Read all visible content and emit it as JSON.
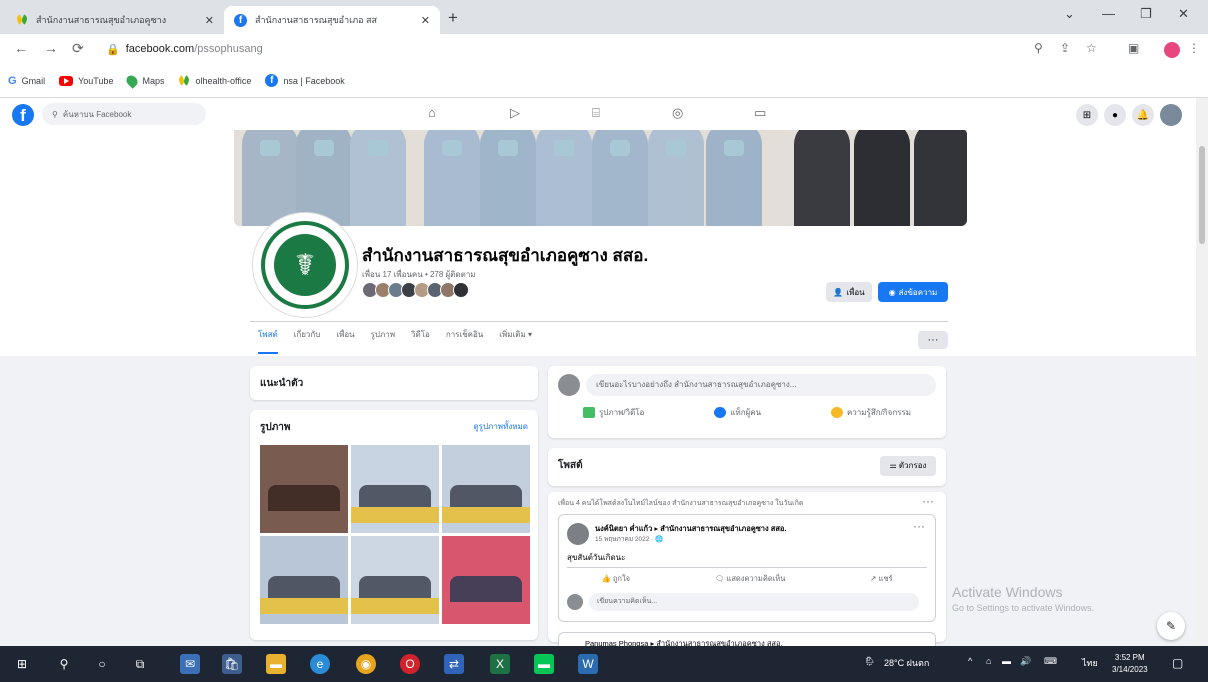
{
  "browser": {
    "tabs": [
      {
        "title": "สำนักงานสาธารณสุขอำเภอคูซาง"
      },
      {
        "title": "สำนักงานสาธารณสุขอำเภอ สส"
      }
    ],
    "url_host": "facebook.com",
    "url_path": "/pssophusang",
    "bookmarks": [
      "Gmail",
      "YouTube",
      "Maps",
      "olhealth-office",
      "nsa | Facebook"
    ]
  },
  "facebook": {
    "search_placeholder": "ค้นหาบน Facebook",
    "page_name": "สำนักงานสาธารณสุขอำเภอคูซาง สสอ.",
    "page_stats": "เพื่อน 17 เพื่อนคน • 278 ผู้ติดตาม",
    "friend_button": "เพื่อน",
    "message_button": "ส่งข้อความ",
    "tabs": [
      "โพสต์",
      "เกี่ยวกับ",
      "เพื่อน",
      "รูปภาพ",
      "วิดีโอ",
      "การเช็คอิน",
      "เพิ่มเติม ▾"
    ],
    "intro_title": "แนะนำตัว",
    "photos_title": "รูปภาพ",
    "photos_link": "ดูรูปภาพทั้งหมด",
    "composer_placeholder": "เขียนอะไรบางอย่างถึง สำนักงานสาธารณสุขอำเภอคูซาง...",
    "composer_actions": [
      "รูปภาพ/วิดีโอ",
      "แท็กผู้คน",
      "ความรู้สึก/กิจกรรม"
    ],
    "posts_title": "โพสต์",
    "filter_button": "ตัวกรอง",
    "feed_line": "เพื่อน 4 คนได้โพสต์ลงในไทม์ไลน์ของ สำนักงานสาธารณสุขอำเภอคูซาง ในวันเกิด",
    "post_author": "นงค์นิตยา ค่ำแก้ว ▸ สำนักงานสาธารณสุขอำเภอคูซาง สสอ.",
    "post_date": "15 พฤษภาคม 2022 · 🌐",
    "post_text": "สุขสันต์วันเกิดนะ",
    "post_actions": [
      "ถูกใจ",
      "แสดงความคิดเห็น",
      "แชร์"
    ],
    "comment_placeholder": "เขียนความคิดเห็น...",
    "next_post_author": "Panumas Phongsa ▸ สำนักงานสาธารณสุขอำเภอคูซาง สสอ."
  },
  "windows": {
    "watermark_title": "Activate Windows",
    "watermark_sub": "Go to Settings to activate Windows.",
    "weather": "28°C ฝนตก",
    "lang": "ไทย",
    "time": "3:52 PM",
    "date": "3/14/2023"
  }
}
